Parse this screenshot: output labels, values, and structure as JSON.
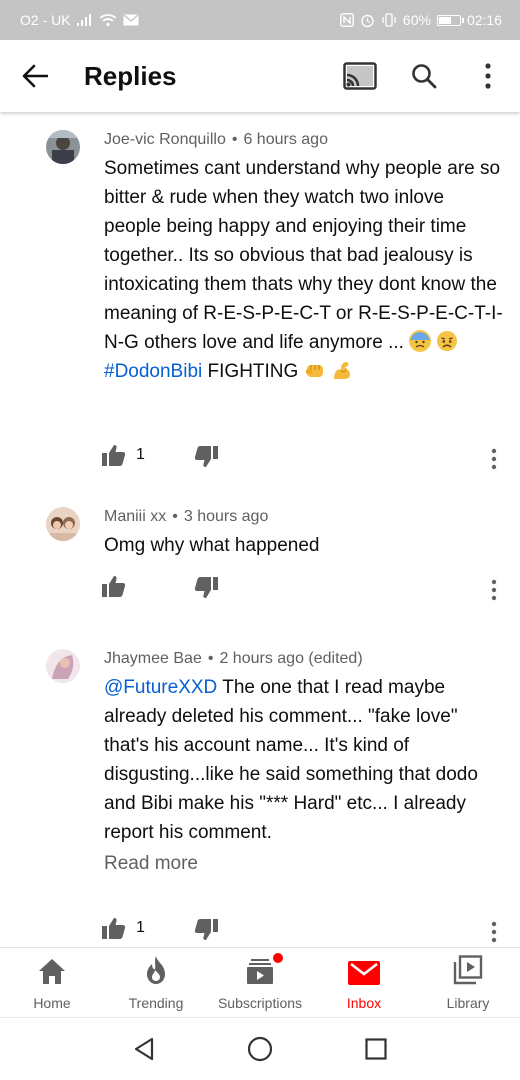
{
  "status_bar": {
    "carrier": "O2 - UK",
    "battery": "60%",
    "battery_level": 0.6,
    "time": "02:16"
  },
  "app_bar": {
    "title": "Replies",
    "icons": [
      "back-arrow-icon",
      "cast-icon",
      "search-icon",
      "more-vert-icon"
    ]
  },
  "comments": [
    {
      "author": "Joe-vic Ronquillo",
      "separator": "•",
      "time": "6 hours ago",
      "text_before": "Sometimes cant understand why people are so bitter & rude when they watch two inlove people being happy and enjoying their time together.. Its so obvious that bad jealousy is intoxicating them thats why they dont know the meaning of R-E-S-P-E-C-T or R-E-S-P-E-C-T-I-N-G  others love and life anymore ... ",
      "hashtag": "#DodonBibi",
      "text_after": " FIGHTING ",
      "emojis": [
        "cold-sweat-face-emoji",
        "sad-face-emoji",
        "fist-emoji",
        "flexed-biceps-emoji"
      ],
      "likes": "1"
    },
    {
      "author": "Maniii xx",
      "separator": "•",
      "time": "3 hours ago",
      "text": "Omg why what happened",
      "likes": ""
    },
    {
      "author": "Jhaymee Bae",
      "separator": "•",
      "time": "2 hours ago (edited)",
      "mention": "@FutureXXD",
      "text": " The one that I read maybe already deleted his comment... \"fake love\" that's his account name... It's kind of disgusting...like he said something  that dodo and Bibi make his \"*** Hard\" etc... I already report his comment.",
      "read_more": "Read more",
      "likes": "1"
    }
  ],
  "bottom_nav": [
    {
      "label": "Home",
      "icon": "home-icon"
    },
    {
      "label": "Trending",
      "icon": "trending-flame-icon"
    },
    {
      "label": "Subscriptions",
      "icon": "subscriptions-icon"
    },
    {
      "label": "Inbox",
      "icon": "inbox-mail-icon",
      "active": true
    },
    {
      "label": "Library",
      "icon": "library-icon"
    }
  ],
  "colors": {
    "accent": "#ff0000",
    "link": "#065fd4",
    "secondary_text": "#606060",
    "status_bar": "#c4c4c4"
  }
}
